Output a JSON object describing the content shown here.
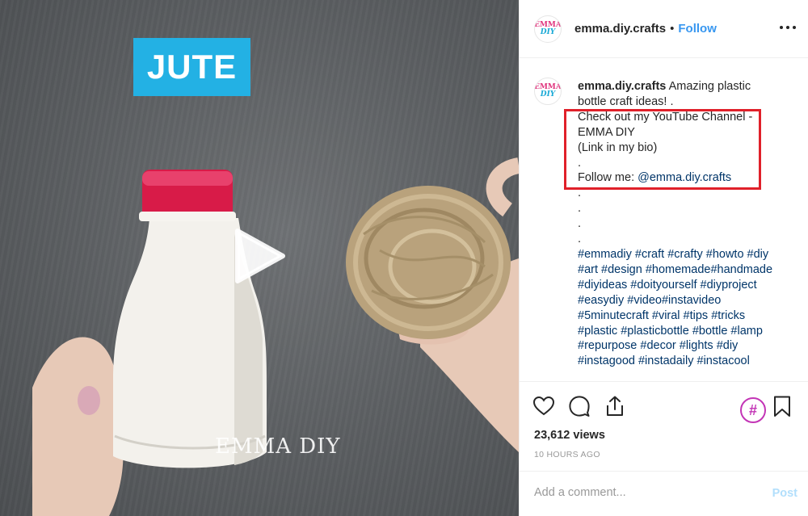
{
  "media": {
    "label_tag": "JUTE",
    "watermark": "EMMA DIY"
  },
  "header": {
    "avatar_line1": "EMMA",
    "avatar_line2": "DIY",
    "username": "emma.diy.crafts",
    "separator": "•",
    "follow_label": "Follow"
  },
  "caption": {
    "username": "emma.diy.crafts",
    "lines": [
      "Amazing plastic",
      "bottle craft ideas! .",
      "Check out my YouTube Channel -",
      "EMMA DIY",
      "(Link in my bio)",
      ".",
      "Follow me:",
      ".",
      ".",
      ".",
      ".",
      "#emmadiy #craft #crafty #howto #diy",
      "#art #design #homemade#handmade",
      "#diyideas #doityourself #diyproject",
      "#easydiy #video#instavideo",
      "#5minutecraft #viral #tips #tricks",
      "#plastic #plasticbottle #bottle #lamp",
      "#repurpose #decor #lights #diy",
      "#instagood #instadaily #instacool"
    ],
    "mention": "@emma.diy.crafts"
  },
  "stats": {
    "views": "23,612 views",
    "timestamp": "10 HOURS AGO"
  },
  "comment_box": {
    "placeholder": "Add a comment...",
    "post_label": "Post"
  },
  "colors": {
    "follow": "#3897f0",
    "hashtag": "#003569",
    "highlight_box": "#e0202a",
    "jute_tag": "#23b1e4",
    "bottle_cap": "#d81b48"
  }
}
